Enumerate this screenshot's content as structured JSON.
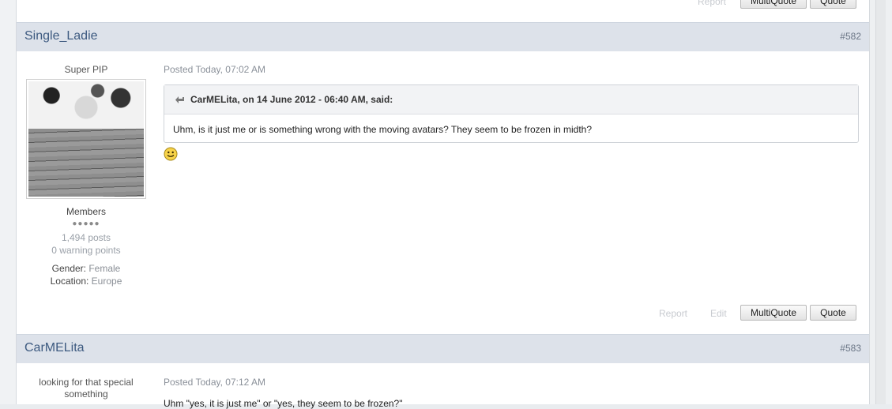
{
  "top_controls": {
    "report": "Report",
    "multiquote": "MultiQuote",
    "quote": "Quote"
  },
  "posts": [
    {
      "author": "Single_Ladie",
      "number": "#582",
      "user_title": "Super PIP",
      "group": "Members",
      "pips": "●●●●●",
      "posts_count": "1,494 posts",
      "warning_points": "0 warning points",
      "gender_label": "Gender:",
      "gender": "Female",
      "location_label": "Location:",
      "location": "Europe",
      "posted": "Posted Today, 07:02 AM",
      "quote_citation": "CarMELita, on 14 June 2012 - 06:40 AM, said:",
      "quote_text": "Uhm, is it just me or is something wrong with the moving avatars? They seem to be frozen in midth?",
      "controls": {
        "report": "Report",
        "edit": "Edit",
        "multiquote": "MultiQuote",
        "quote": "Quote"
      }
    },
    {
      "author": "CarMELita",
      "number": "#583",
      "user_title_line1": "looking for that special",
      "user_title_line2": "something",
      "posted": "Posted Today, 07:12 AM",
      "body_text": "Uhm \"yes, it is just me\" or \"yes, they seem to be frozen?\""
    }
  ],
  "colors": {
    "header_bg": "#dde2ea",
    "author_link": "#3d5a80",
    "button_border": "#b8b8b8"
  }
}
